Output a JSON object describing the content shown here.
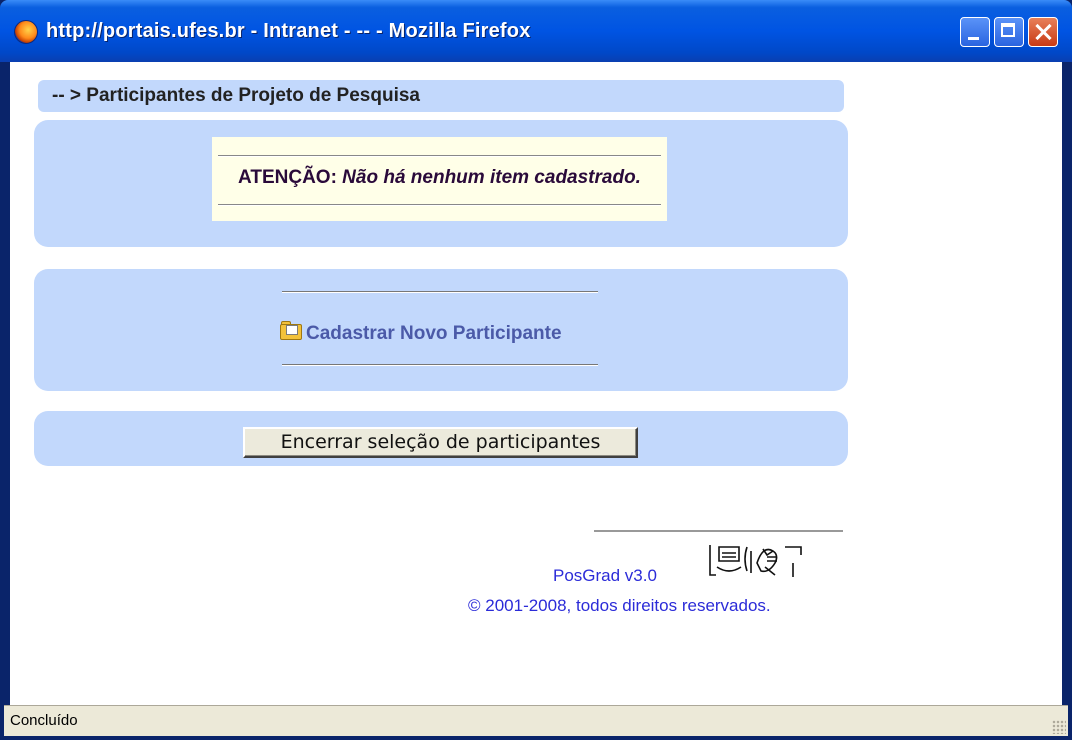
{
  "window": {
    "title": "http://portais.ufes.br - Intranet - -- - Mozilla Firefox"
  },
  "breadcrumb": "-- > Participantes de Projeto de Pesquisa",
  "alert": {
    "label": "ATENÇÃO:",
    "message": "Não há nenhum item cadastrado."
  },
  "add_link": {
    "label": "Cadastrar Novo Participante"
  },
  "end_button": {
    "label": "Encerrar seleção de participantes"
  },
  "footer": {
    "version": "PosGrad v3.0",
    "copyright": "© 2001-2008, todos direitos reservados."
  },
  "status": {
    "text": "Concluído"
  },
  "colors": {
    "panel": "#c2d8fc",
    "alert_bg": "#ffffe8",
    "link": "#4b5aa8",
    "footer_text": "#2b2bd8"
  }
}
